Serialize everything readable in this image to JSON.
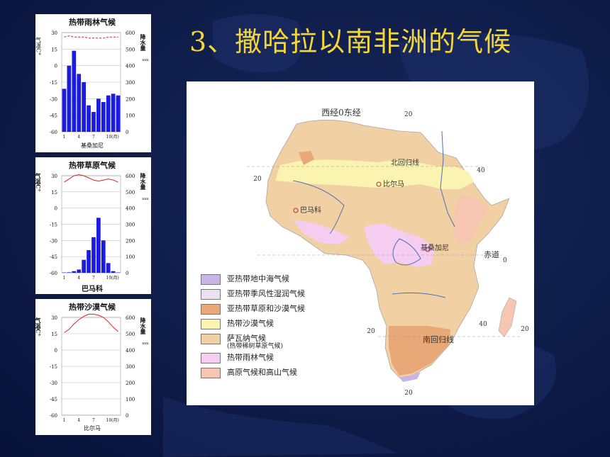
{
  "title": "3、撒哈拉以南非洲的气候",
  "charts": [
    {
      "title": "热带雨林气候",
      "city": "基桑加尼",
      "left_axis_label": "气温C°",
      "right_axis_label": "降水量",
      "right_unit": "mm",
      "y_ticks": [
        "30",
        "15",
        "0",
        "-15",
        "-30",
        "-45",
        "-60"
      ],
      "r_ticks": [
        "600",
        "500",
        "400",
        "300",
        "200",
        "100",
        "0"
      ],
      "x_ticks": [
        "1",
        "4",
        "7",
        "10(月)"
      ]
    },
    {
      "title": "热带草原气候",
      "city": "巴马科",
      "left_axis_label": "气温C°",
      "right_axis_label": "降水量",
      "right_unit": "mm",
      "y_ticks": [
        "30",
        "15",
        "0",
        "-15",
        "-30",
        "-45",
        "-60"
      ],
      "r_ticks": [
        "600",
        "500",
        "400",
        "300",
        "200",
        "100",
        "0"
      ],
      "x_ticks": [
        "1",
        "4",
        "7",
        "10(月)"
      ]
    },
    {
      "title": "热带沙漠气候",
      "city": "比尔马",
      "left_axis_label": "气温C°",
      "right_axis_label": "降水量",
      "right_unit": "mm",
      "y_ticks": [
        "30",
        "15",
        "0",
        "-15",
        "-30",
        "-45",
        "-60"
      ],
      "r_ticks": [
        "600",
        "500",
        "400",
        "300",
        "200",
        "100",
        "0"
      ],
      "x_ticks": [
        "1",
        "4",
        "7",
        "10(月)"
      ]
    }
  ],
  "chart_data": [
    {
      "type": "bar",
      "title": "热带雨林气候",
      "months": [
        1,
        2,
        3,
        4,
        5,
        6,
        7,
        8,
        9,
        10,
        11,
        12
      ],
      "precip_mm": [
        260,
        400,
        490,
        350,
        300,
        160,
        120,
        200,
        180,
        220,
        230,
        220
      ],
      "temp_c": [
        26,
        27,
        26,
        26,
        26,
        25,
        25,
        25,
        25,
        26,
        26,
        26
      ],
      "ylim_temp": [
        -60,
        30
      ],
      "ylim_precip": [
        0,
        600
      ]
    },
    {
      "type": "bar",
      "title": "热带草原气候",
      "months": [
        1,
        2,
        3,
        4,
        5,
        6,
        7,
        8,
        9,
        10,
        11,
        12
      ],
      "precip_mm": [
        2,
        3,
        10,
        20,
        80,
        140,
        220,
        340,
        200,
        60,
        10,
        2
      ],
      "temp_c": [
        24,
        27,
        30,
        31,
        30,
        28,
        26,
        25,
        26,
        27,
        26,
        24
      ],
      "ylim_temp": [
        -60,
        30
      ],
      "ylim_precip": [
        0,
        600
      ]
    },
    {
      "type": "bar",
      "title": "热带沙漠气候",
      "months": [
        1,
        2,
        3,
        4,
        5,
        6,
        7,
        8,
        9,
        10,
        11,
        12
      ],
      "precip_mm": [
        0,
        0,
        0,
        0,
        0,
        0,
        0,
        0,
        0,
        0,
        0,
        0
      ],
      "temp_c": [
        16,
        19,
        24,
        28,
        31,
        33,
        33,
        32,
        30,
        26,
        21,
        17
      ],
      "ylim_temp": [
        -60,
        30
      ],
      "ylim_precip": [
        0,
        600
      ]
    }
  ],
  "map": {
    "labels": {
      "meridian": "西经0东经",
      "tropic_cancer": "北回归线",
      "equator": "赤道",
      "tropic_capricorn": "南回归线",
      "lat20n": "20",
      "lon20": "20",
      "lon40": "40",
      "lon40b": "40",
      "lat20s_l": "20",
      "lat20s_r": "20",
      "lon20s": "20",
      "eq0": "0"
    },
    "cities": {
      "birma": "比尔马",
      "bamako": "巴马科",
      "kisangani": "基桑加尼"
    },
    "legend": [
      {
        "label": "亚热带地中海气候",
        "color": "#c8b4e6"
      },
      {
        "label": "亚热带季风性湿润气候",
        "color": "#ece0f2"
      },
      {
        "label": "亚热带草原和沙漠气候",
        "color": "#e8a878"
      },
      {
        "label": "热带沙漠气候",
        "color": "#fbf3b0"
      },
      {
        "label": "萨瓦纳气候",
        "sub": "(热带稀树草原气候)",
        "color": "#f1d0a4"
      },
      {
        "label": "热带雨林气候",
        "color": "#f4cdf0"
      },
      {
        "label": "高原气候和高山气候",
        "color": "#f6c6b2"
      }
    ]
  }
}
